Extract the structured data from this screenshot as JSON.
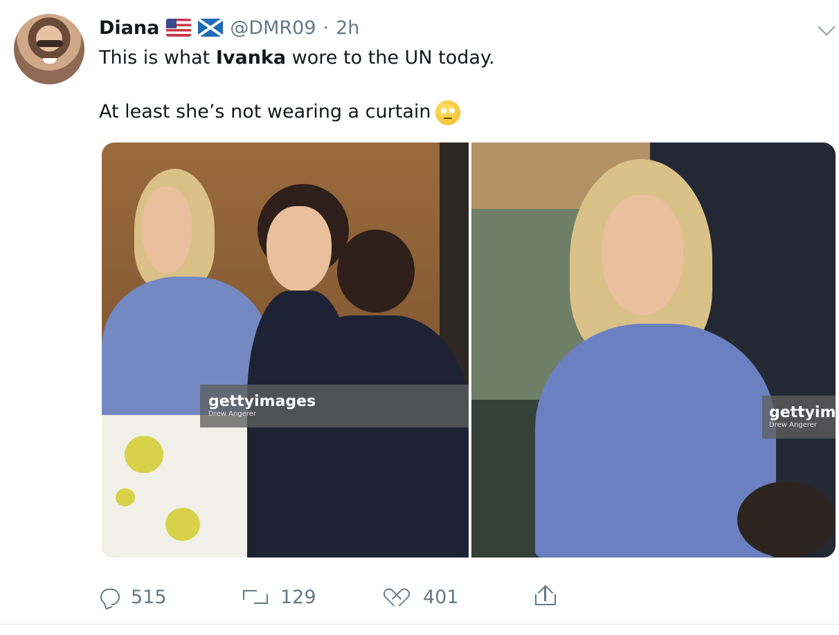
{
  "tweet": {
    "author_name": "Diana",
    "author_flags": [
      "us-flag-icon",
      "scotland-flag-icon"
    ],
    "handle": "@DMR09",
    "separator": "·",
    "time": "2h",
    "text": {
      "line1_before": "This is what ",
      "line1_bold": "Ivanka",
      "line1_after": " wore to the UN today.",
      "line2": "At least she’s not wearing a curtain"
    },
    "emoji": "face-with-rolling-eyes"
  },
  "media": {
    "photos": [
      {
        "watermark": "gettyimages",
        "credit": "Drew Angerer"
      },
      {
        "watermark": "gettyimag",
        "credit": "Drew Angerer"
      }
    ]
  },
  "actions": {
    "replies": "515",
    "retweets": "129",
    "likes": "401"
  },
  "colors": {
    "text": "#14171a",
    "muted": "#657786",
    "background": "#ffffff"
  }
}
